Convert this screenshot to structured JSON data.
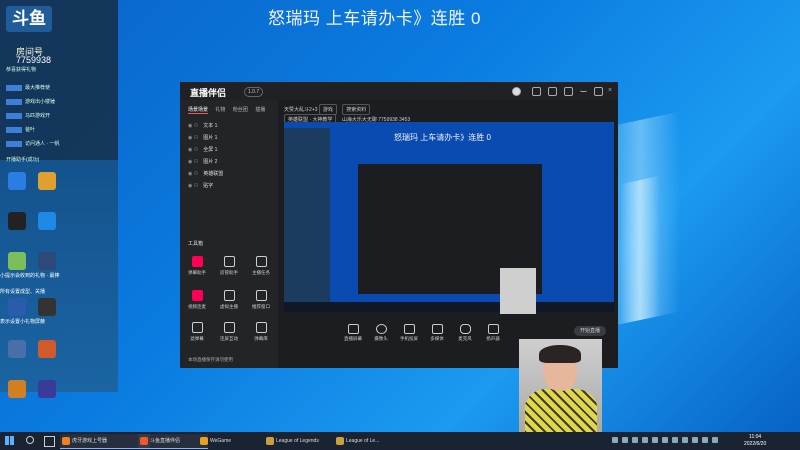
{
  "banner": "怒瑞玛  上车请办卡》连胜 0",
  "chat": {
    "logo": "斗鱼",
    "room_label": "房间号",
    "room_number": "7759938",
    "notice": "恭喜获得礼物",
    "messages": [
      "最大推荐使",
      "游戏出小楼锤",
      "马匹游戏开",
      "爸叶",
      "访问通人 · 一帆"
    ],
    "left_note": "开播助手(成功)",
    "desktop_notes": [
      "小提示会收到的礼物 · 最棒",
      "所有设置成型、关播",
      "表示设置小礼物屏蔽"
    ]
  },
  "window": {
    "app_name": "直播伴侣",
    "version": "1.0.7",
    "tabs": [
      "场景场景",
      "礼物",
      "粉丝团",
      "插播"
    ],
    "scenes": [
      "文本 1",
      "图片 1",
      "全屏 1",
      "图片 2",
      "英雄联盟",
      "贴字"
    ],
    "tools_title": "工具箱",
    "tools": [
      "弹幕助手",
      "房管助手",
      "主播任务",
      "视频连麦",
      "虚拟主播",
      "推荐窗口",
      "滤弹幕",
      "连屏互动",
      "弹幕库"
    ],
    "topbar": [
      "天赞大乱斗2+3",
      "游戏",
      "搜索资料",
      "英雄联盟 · 大神教学",
      "山海大乐大无聊",
      "7759938",
      "3453"
    ],
    "preview_banner": "怒瑞玛  上车请办卡》连胜 0",
    "controls": [
      "直播屏幕",
      "摄像头",
      "手机投屏",
      "多媒体",
      "麦克风",
      "扬声器"
    ],
    "start_button": "开始直播",
    "bottom_hint": "本场直播保存请勿使用"
  },
  "taskbar": {
    "apps": [
      "虎牙游戏上号器",
      "斗鱼直播伴侣",
      "WeGame",
      "League of Legends",
      "League of Le..."
    ],
    "time": "11:04",
    "date": "2022/6/20"
  },
  "colors": {
    "accent": "#0a7be0",
    "taskbar": "#1a2332",
    "window": "#1c1d21",
    "chat": "#16324f"
  }
}
